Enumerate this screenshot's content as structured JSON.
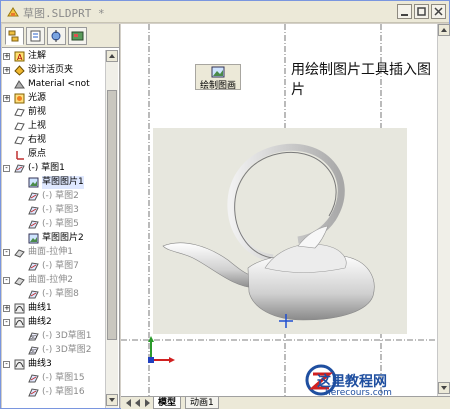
{
  "window": {
    "title": "草图.SLDPRT *",
    "buttons": [
      "minimize",
      "maximize",
      "close"
    ]
  },
  "left_tabs": [
    "feature-manager-icon",
    "property-manager-icon",
    "configuration-manager-icon",
    "display-manager-icon"
  ],
  "tree": [
    {
      "label": "注解",
      "icon": "annotation-icon",
      "expand": "+",
      "dim": false
    },
    {
      "label": "设计活页夹",
      "icon": "design-binder-icon",
      "expand": "+",
      "dim": false
    },
    {
      "label": "Material <not",
      "icon": "material-icon",
      "expand": "",
      "dim": false
    },
    {
      "label": "光源",
      "icon": "lights-icon",
      "expand": "+",
      "dim": false
    },
    {
      "label": "前视",
      "icon": "plane-icon",
      "expand": "",
      "dim": false
    },
    {
      "label": "上视",
      "icon": "plane-icon",
      "expand": "",
      "dim": false
    },
    {
      "label": "右视",
      "icon": "plane-icon",
      "expand": "",
      "dim": false
    },
    {
      "label": "原点",
      "icon": "origin-icon",
      "expand": "",
      "dim": false
    },
    {
      "label": "(-) 草图1",
      "icon": "sketch-icon",
      "expand": "-",
      "dim": false
    },
    {
      "label": "草图图片1",
      "icon": "sketch-picture-icon",
      "expand": "",
      "dim": false,
      "selected": true
    },
    {
      "label": "(-) 草图2",
      "icon": "sketch-icon",
      "expand": "",
      "dim": true
    },
    {
      "label": "(-) 草图3",
      "icon": "sketch-icon",
      "expand": "",
      "dim": true
    },
    {
      "label": "(-) 草图5",
      "icon": "sketch-icon",
      "expand": "",
      "dim": true
    },
    {
      "label": "草图图片2",
      "icon": "sketch-picture-icon",
      "expand": "",
      "dim": false
    },
    {
      "label": "曲面-拉伸1",
      "icon": "surface-extrude-icon",
      "expand": "-",
      "dim": true
    },
    {
      "label": "(-) 草图7",
      "icon": "sketch-icon",
      "expand": "",
      "dim": true
    },
    {
      "label": "曲面-拉伸2",
      "icon": "surface-extrude-icon",
      "expand": "-",
      "dim": true
    },
    {
      "label": "(-) 草图8",
      "icon": "sketch-icon",
      "expand": "",
      "dim": true
    },
    {
      "label": "曲线1",
      "icon": "curve-icon",
      "expand": "+",
      "dim": false
    },
    {
      "label": "曲线2",
      "icon": "curve-icon",
      "expand": "-",
      "dim": false
    },
    {
      "label": "(-) 3D草图1",
      "icon": "sketch3d-icon",
      "expand": "",
      "dim": true
    },
    {
      "label": "(-) 3D草图2",
      "icon": "sketch3d-icon",
      "expand": "",
      "dim": true
    },
    {
      "label": "曲线3",
      "icon": "curve-icon",
      "expand": "-",
      "dim": false
    },
    {
      "label": "(-) 草图15",
      "icon": "sketch-icon",
      "expand": "",
      "dim": true
    },
    {
      "label": "(-) 草图16",
      "icon": "sketch-icon",
      "expand": "",
      "dim": true
    }
  ],
  "canvas": {
    "draw_button_label": "绘制图画",
    "caption": "用绘制图片工具插入图片"
  },
  "bottom_tabs": {
    "model": "模型",
    "animation": "动画1"
  },
  "watermark": {
    "title": "这里教程网",
    "subtitle": "herecours.com"
  },
  "colors": {
    "titlebar": "#ece9d8",
    "selection": "#dfe8ff",
    "dim_text": "#8a8a8a",
    "watermark": "#1f4fa0"
  }
}
